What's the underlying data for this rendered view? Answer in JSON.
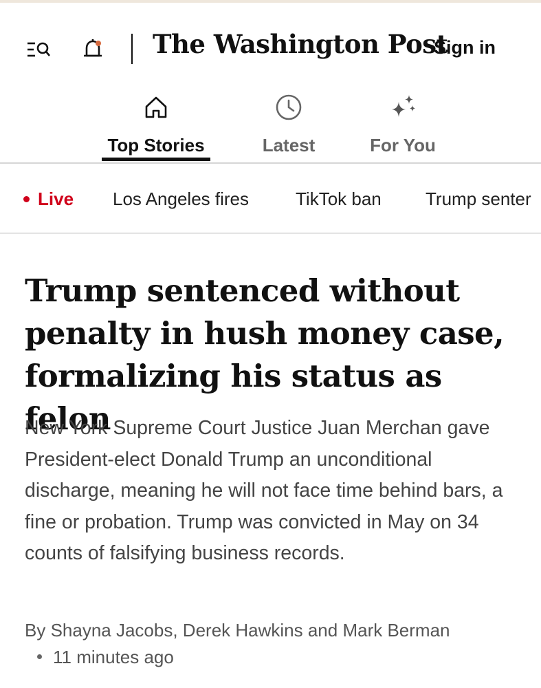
{
  "header": {
    "logo": "The Washington Post",
    "sign_in": "Sign in",
    "icons": [
      "menu-search-icon",
      "bell-icon"
    ]
  },
  "tabs": [
    {
      "label": "Top Stories",
      "icon": "home-icon",
      "active": true
    },
    {
      "label": "Latest",
      "icon": "clock-icon",
      "active": false
    },
    {
      "label": "For You",
      "icon": "sparkle-icon",
      "active": false
    }
  ],
  "topics": [
    {
      "label": "Live"
    },
    {
      "label": "Los Angeles fires"
    },
    {
      "label": "TikTok ban"
    },
    {
      "label": "Trump senter"
    }
  ],
  "article": {
    "headline": "Trump sentenced without penalty in hush money case, formalizing his status as felon",
    "summary": "New York Supreme Court Justice Juan Merchan gave President-elect Donald Trump an unconditional discharge, meaning he will not face time behind bars, a fine or probation. Trump was convicted in May on 34 counts of falsifying business records.",
    "byline": "By Shayna Jacobs, Derek Hawkins and Mark Berman",
    "timestamp": "11 minutes ago"
  },
  "colors": {
    "live_red": "#d0021b",
    "text_dark": "#111111",
    "text_muted": "#666666"
  }
}
